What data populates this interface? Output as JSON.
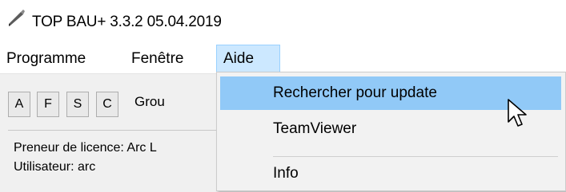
{
  "window": {
    "title": "TOP BAU+ 3.3.2  05.04.2019",
    "icon": "pen-app-icon"
  },
  "menubar": {
    "items": [
      "Programme",
      "Fenêtre",
      "Aide"
    ],
    "active": "Aide"
  },
  "toolbar": {
    "buttons": [
      "A",
      "F",
      "S",
      "C"
    ],
    "group_label": "Grou"
  },
  "info": {
    "licensee": "Preneur de licence: Arc L",
    "user": "Utilisateur: arc"
  },
  "dropdown": {
    "items": [
      "Rechercher pour update",
      "TeamViewer",
      "Info"
    ],
    "highlighted": "Rechercher pour update"
  },
  "colors": {
    "menu_highlight": "#91c9f7",
    "active_menu_bg": "#cce8ff"
  }
}
